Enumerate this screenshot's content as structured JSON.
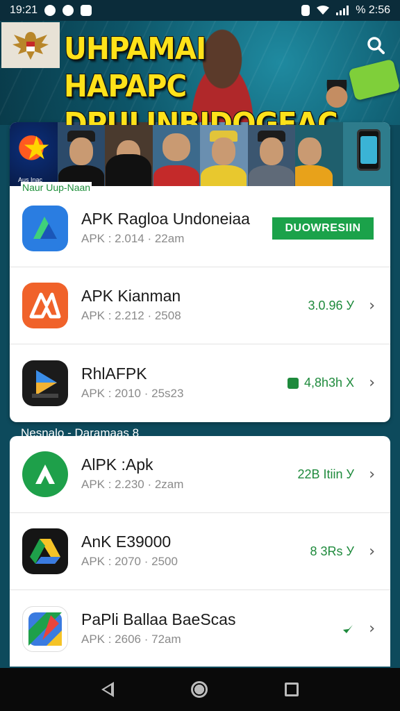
{
  "status_bar": {
    "time": "19:21",
    "right_text": "% 2:56"
  },
  "banner": {
    "title_line1": "UHPAMAI HAPAPC",
    "title_line2": "DPULINBIDOGEAC"
  },
  "strip": {
    "star_tile_text": "Aus Inac",
    "section_label": "Naur Uup-Naan"
  },
  "apps_top": [
    {
      "name": "APK Ragloa Undoneiaa",
      "meta": "APK : 2.014 · 22am",
      "action": "DUOWRESIIN",
      "icon": "apk-arrow-icon",
      "color": "#2a7de1"
    },
    {
      "name": "APK Kianman",
      "meta": "APK : 2.212 · 2508",
      "stat": "3.0.96 У",
      "icon": "apk-kineMaster-icon",
      "color": "#f0622a"
    },
    {
      "name": "RhlAFPK",
      "meta": "APK : 2010 · 25s23",
      "stat": "4,8h3h X",
      "icon": "play-arrow-icon",
      "color": "#1b1b1b"
    }
  ],
  "section2": {
    "label": "Nesnalo - Daramaas 8"
  },
  "apps_bottom": [
    {
      "name": "AlPK :Apk",
      "meta": "APK : 2.230 · 2zam",
      "stat": "22B Itiin У",
      "icon": "apk-green-icon",
      "color": "#1ea04a"
    },
    {
      "name": "AnK E39000",
      "meta": "APK : 2070 · 2500",
      "stat": "8 3Rs У",
      "icon": "drive-icon",
      "color": "#151515"
    },
    {
      "name": "PaPli Ballaa BaeScas",
      "meta": "APK : 2606 · 72am",
      "stat": "",
      "icon": "maps-icon",
      "color": "#ffffff"
    }
  ],
  "colors": {
    "accent_green": "#1ba24a",
    "banner_yellow": "#ffe21a"
  }
}
